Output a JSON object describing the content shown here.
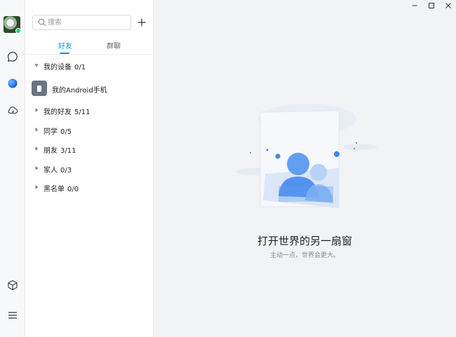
{
  "search": {
    "placeholder": "搜索"
  },
  "tabs": [
    {
      "label": "好友"
    },
    {
      "label": "群聊"
    }
  ],
  "groups": [
    {
      "name": "我的设备",
      "count": "0/1",
      "expanded": true
    },
    {
      "name": "我的好友",
      "count": "5/11",
      "expanded": false
    },
    {
      "name": "同学",
      "count": "0/5",
      "expanded": false
    },
    {
      "name": "朋友",
      "count": "3/11",
      "expanded": false
    },
    {
      "name": "家人",
      "count": "0/3",
      "expanded": false
    },
    {
      "name": "黑名单",
      "count": "0/0",
      "expanded": false
    }
  ],
  "device": {
    "name": "我的Android手机"
  },
  "main": {
    "title": "打开世界的另一扇窗",
    "subtitle": "主动一点，世界会更大。"
  },
  "icons": [
    "search-icon",
    "plus-icon",
    "message-icon",
    "qq-space-icon",
    "cloud-icon",
    "cube-icon",
    "menu-icon",
    "minimize-icon",
    "maximize-icon",
    "close-icon"
  ],
  "colors": {
    "accent": "#0099ff",
    "online": "#2ecc71",
    "device": "#6b7483"
  }
}
